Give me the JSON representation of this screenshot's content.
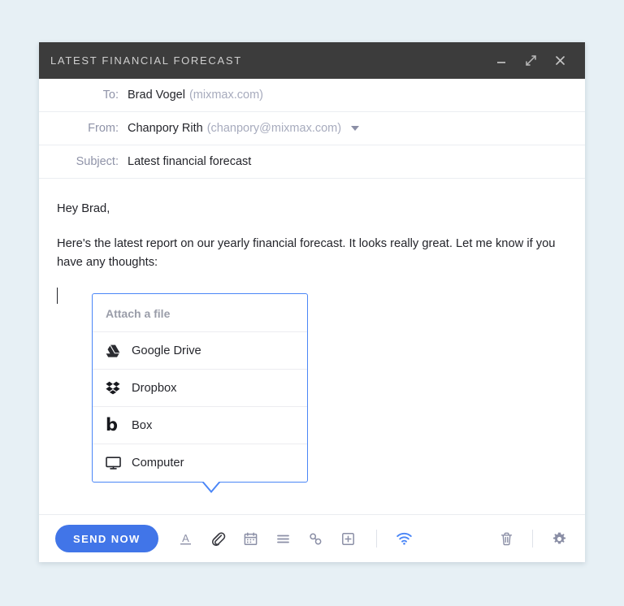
{
  "window": {
    "title": "LATEST FINANCIAL FORECAST",
    "controls": [
      {
        "name": "minimize-button",
        "icon": "minimize-icon"
      },
      {
        "name": "expand-button",
        "icon": "expand-icon"
      },
      {
        "name": "close-button",
        "icon": "close-icon"
      }
    ]
  },
  "header": {
    "to": {
      "label": "To:",
      "value": "Brad Vogel",
      "domain": "(mixmax.com)"
    },
    "from": {
      "label": "From:",
      "value": "Chanpory Rith",
      "domain": "(chanpory@mixmax.com)"
    },
    "subject": {
      "label": "Subject:",
      "value": "Latest financial forecast"
    }
  },
  "body": {
    "greeting": "Hey Brad,",
    "paragraph": "Here's the latest report on our yearly financial forecast. It looks really great. Let me know if you have any thoughts:"
  },
  "attach_popup": {
    "title": "Attach a file",
    "items": [
      {
        "label": "Google Drive",
        "icon": "google-drive-icon"
      },
      {
        "label": "Dropbox",
        "icon": "dropbox-icon"
      },
      {
        "label": "Box",
        "icon": "box-icon",
        "glyph": "b"
      },
      {
        "label": "Computer",
        "icon": "computer-icon"
      }
    ]
  },
  "toolbar": {
    "send_label": "SEND NOW",
    "tools": [
      {
        "name": "format-text-button",
        "icon": "underlined-a-icon"
      },
      {
        "name": "attach-file-button",
        "icon": "paperclip-icon"
      },
      {
        "name": "calendar-button",
        "icon": "calendar-icon"
      },
      {
        "name": "sequence-button",
        "icon": "list-lines-icon"
      },
      {
        "name": "link-button",
        "icon": "link-icon"
      },
      {
        "name": "insert-button",
        "icon": "plus-box-icon"
      },
      {
        "name": "tracking-button",
        "icon": "wifi-icon"
      }
    ],
    "right_tools": [
      {
        "name": "delete-draft-button",
        "icon": "trash-icon"
      },
      {
        "name": "settings-button",
        "icon": "gear-icon"
      }
    ]
  },
  "colors": {
    "page_background": "#e7f0f5",
    "titlebar": "#3c3c3c",
    "accent_blue": "#4175e8",
    "popup_border": "#4a86f7",
    "tracking_blue": "#4a86f7",
    "icon_gray": "#8b8fa6",
    "icon_active": "#3a3b42"
  }
}
